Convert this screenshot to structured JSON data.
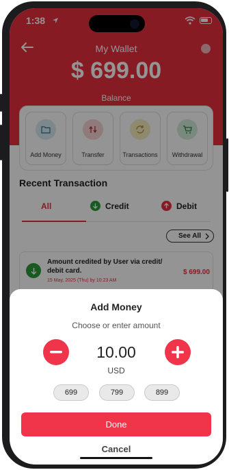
{
  "status_bar": {
    "time": "1:38"
  },
  "header": {
    "title": "My Wallet",
    "balance": "$ 699.00",
    "balance_label": "Balance"
  },
  "actions": [
    {
      "label": "Add Money",
      "icon": "wallet-icon",
      "color": "#d6eaf2"
    },
    {
      "label": "Transfer",
      "icon": "transfer-icon",
      "color": "#f6d5d5"
    },
    {
      "label": "Transactions",
      "icon": "refresh-icon",
      "color": "#f7ecc2"
    },
    {
      "label": "Withdrawal",
      "icon": "cart-icon",
      "color": "#d3ecd8"
    }
  ],
  "recent": {
    "title": "Recent Transaction",
    "tabs": [
      "All",
      "Credit",
      "Debit"
    ],
    "see_all": "See All",
    "transaction": {
      "description": "Amount credited by User via credit/ debit card.",
      "date": "15 May, 2025 (Thu) by 10:23 AM",
      "amount": "$ 699.00"
    }
  },
  "add_money": {
    "title": "Add Money",
    "subtitle": "Choose or enter amount",
    "amount": "10.00",
    "currency": "USD",
    "presets": [
      "699",
      "799",
      "899"
    ],
    "done_label": "Done",
    "cancel_label": "Cancel"
  },
  "colors": {
    "accent": "#f0344a",
    "credit": "#2e9a3a",
    "debit": "#e9303e"
  }
}
